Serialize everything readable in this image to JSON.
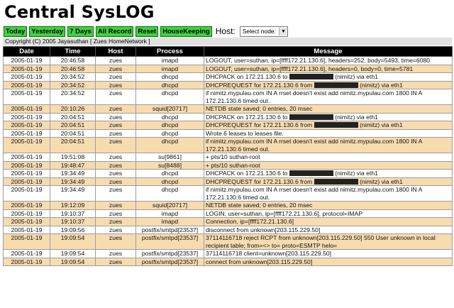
{
  "title": "Central SysLOG",
  "toolbar": {
    "buttons": [
      "Today",
      "Yesterday",
      "7 Days",
      "All Record",
      "Reset",
      "HouseKeeping"
    ],
    "host_label": "Host:",
    "host_select": "Select node:"
  },
  "copyright": "Copyright (C) 2005 Jayasuthan [ Zues HomeNetwork ]",
  "table": {
    "headers": [
      "Date",
      "Time",
      "Host",
      "Process",
      "Message"
    ],
    "rows": [
      {
        "date": "2005-01-19",
        "time": "20:46:58",
        "host": "zues",
        "process": "imapd",
        "msg1": "LOGOUT, user=suthan, ip=[ffff172.21.130.6], headers=252, body=5493, time=6080"
      },
      {
        "date": "2005-01-19",
        "time": "20:46:58",
        "host": "zues",
        "process": "imapd",
        "msg1": "LOGOUT, user=suthan, ip=[ffff172.21.130.6], headers=0, body=0, time=5781"
      },
      {
        "date": "2005-01-19",
        "time": "20:34:52",
        "host": "zues",
        "process": "dhcpd",
        "msg1": "DHCPACK on 172.21.130.6 to ",
        "msg2": " (nimitz) via eth1"
      },
      {
        "date": "2005-01-19",
        "time": "20:34:52",
        "host": "zues",
        "process": "dhcpd",
        "msg1": "DHCPREQUEST for 172.21.130.6 from ",
        "msg2": " (nimitz) via eth1"
      },
      {
        "date": "2005-01-19",
        "time": "20:34:52",
        "host": "zues",
        "process": "dhcpd",
        "msg1": "if nimitz.mypulau.com IN A rrset doesn't exist add nimitz.mypulau.com 1800 IN A 172.21.130.6 timed out."
      },
      {
        "date": "2005-01-19",
        "time": "20:10:26",
        "host": "zues",
        "process": "squid[20717]",
        "msg1": "NETDB state saved; 0 entries, 20 msec"
      },
      {
        "date": "2005-01-19",
        "time": "20:04:51",
        "host": "zues",
        "process": "dhcpd",
        "msg1": "DHCPACK on 172.21.130.6 to ",
        "msg2": " (nimitz) via eth1"
      },
      {
        "date": "2005-01-19",
        "time": "20:04:51",
        "host": "zues",
        "process": "dhcpd",
        "msg1": "DHCPREQUEST for 172.21.130.6 from ",
        "msg2": " (nimitz) via eth1"
      },
      {
        "date": "2005-01-19",
        "time": "20:04:51",
        "host": "zues",
        "process": "dhcpd",
        "msg1": "Wrote 6 leases to leases file."
      },
      {
        "date": "2005-01-19",
        "time": "20:04:51",
        "host": "zues",
        "process": "dhcpd",
        "msg1": "if nimitz.mypulau.com IN A rrset doesn't exist add nimitz.mypulau.com 1800 IN A 172.21.130.6 timed out."
      },
      {
        "date": "2005-01-19",
        "time": "19:51:08",
        "host": "zues",
        "process": "su[9861]",
        "msg1": "+ pts/10 suthan-root"
      },
      {
        "date": "2005-01-19",
        "time": "19:48:47",
        "host": "zues",
        "process": "su[8488]",
        "msg1": "+ pts/10 suthan-root"
      },
      {
        "date": "2005-01-19",
        "time": "19:34:49",
        "host": "zues",
        "process": "dhcpd",
        "msg1": "DHCPACK on 172.21.130.6 to ",
        "msg2": " (nimitz) via eth1"
      },
      {
        "date": "2005-01-19",
        "time": "19:34:49",
        "host": "zues",
        "process": "dhcpd",
        "msg1": "DHCPREQUEST for 172.21.130.6 from ",
        "msg2": " (nimitz) via eth1"
      },
      {
        "date": "2005-01-19",
        "time": "19:34:49",
        "host": "zues",
        "process": "dhcpd",
        "msg1": "if nimitz.mypulau.com IN A rrset doesn't exist add nimitz.mypulau.com 1800 IN A 172.21.130.6 timed out."
      },
      {
        "date": "2005-01-19",
        "time": "19:12:09",
        "host": "zues",
        "process": "squid[20717]",
        "msg1": "NETDB state saved; 0 entries, 20 msec"
      },
      {
        "date": "2005-01-19",
        "time": "19:10:37",
        "host": "zues",
        "process": "imapd",
        "msg1": "LOGIN, user=suthan, ip=[ffff172.21.130.6], protocol=IMAP"
      },
      {
        "date": "2005-01-19",
        "time": "19:10:37",
        "host": "zues",
        "process": "imapd",
        "msg1": "Connection, ip=[ffff172.21.130.6]"
      },
      {
        "date": "2005-01-19",
        "time": "19:09:56",
        "host": "zues",
        "process": "postfix/smtpd[23537]",
        "msg1": "disconnect from unknown[203.115.229.50]"
      },
      {
        "date": "2005-01-19",
        "time": "19:09:54",
        "host": "zues",
        "process": "postfix/smtpd[23537]",
        "msg1": "37114116718 reject RCPT from unknown[203.115.229.50] 550 User unknown in local recipient table; from=<> to= proto=ESMTP helo="
      },
      {
        "date": "2005-01-19",
        "time": "19:09:54",
        "host": "zues",
        "process": "postfix/smtpd[23537]",
        "msg1": "37114116718 client=unknown[203.115.229.50]"
      },
      {
        "date": "2005-01-19",
        "time": "19:09:54",
        "host": "zues",
        "process": "postfix/smtpd[23537]",
        "msg1": "connect from unknown[203.115.229.50]"
      }
    ]
  },
  "colors": {
    "button_bg": "#3fd33f",
    "row_alt": "#f7dcb0",
    "header_bg": "#000000"
  }
}
